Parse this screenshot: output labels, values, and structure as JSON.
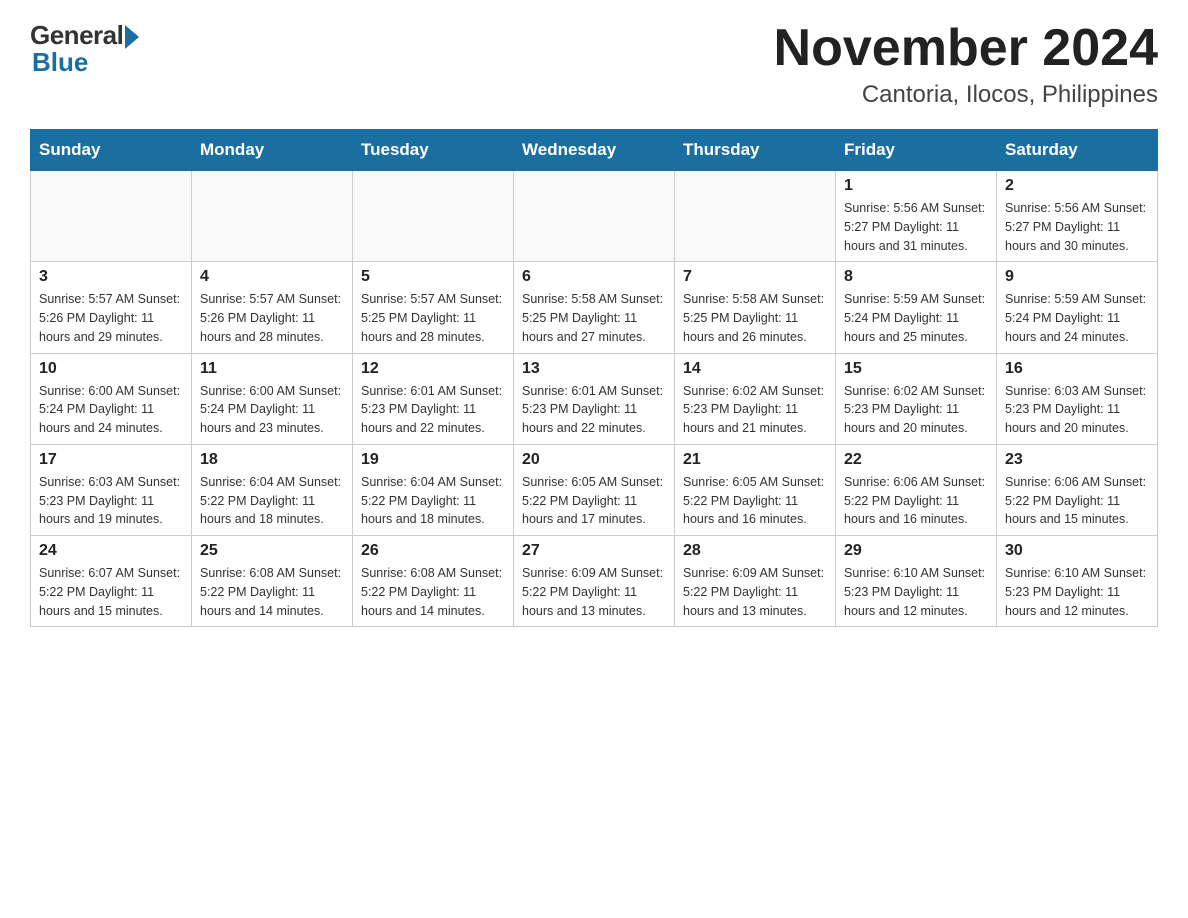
{
  "logo": {
    "general": "General",
    "blue": "Blue"
  },
  "title": "November 2024",
  "subtitle": "Cantoria, Ilocos, Philippines",
  "days_of_week": [
    "Sunday",
    "Monday",
    "Tuesday",
    "Wednesday",
    "Thursday",
    "Friday",
    "Saturday"
  ],
  "weeks": [
    [
      {
        "day": "",
        "info": ""
      },
      {
        "day": "",
        "info": ""
      },
      {
        "day": "",
        "info": ""
      },
      {
        "day": "",
        "info": ""
      },
      {
        "day": "",
        "info": ""
      },
      {
        "day": "1",
        "info": "Sunrise: 5:56 AM\nSunset: 5:27 PM\nDaylight: 11 hours and 31 minutes."
      },
      {
        "day": "2",
        "info": "Sunrise: 5:56 AM\nSunset: 5:27 PM\nDaylight: 11 hours and 30 minutes."
      }
    ],
    [
      {
        "day": "3",
        "info": "Sunrise: 5:57 AM\nSunset: 5:26 PM\nDaylight: 11 hours and 29 minutes."
      },
      {
        "day": "4",
        "info": "Sunrise: 5:57 AM\nSunset: 5:26 PM\nDaylight: 11 hours and 28 minutes."
      },
      {
        "day": "5",
        "info": "Sunrise: 5:57 AM\nSunset: 5:25 PM\nDaylight: 11 hours and 28 minutes."
      },
      {
        "day": "6",
        "info": "Sunrise: 5:58 AM\nSunset: 5:25 PM\nDaylight: 11 hours and 27 minutes."
      },
      {
        "day": "7",
        "info": "Sunrise: 5:58 AM\nSunset: 5:25 PM\nDaylight: 11 hours and 26 minutes."
      },
      {
        "day": "8",
        "info": "Sunrise: 5:59 AM\nSunset: 5:24 PM\nDaylight: 11 hours and 25 minutes."
      },
      {
        "day": "9",
        "info": "Sunrise: 5:59 AM\nSunset: 5:24 PM\nDaylight: 11 hours and 24 minutes."
      }
    ],
    [
      {
        "day": "10",
        "info": "Sunrise: 6:00 AM\nSunset: 5:24 PM\nDaylight: 11 hours and 24 minutes."
      },
      {
        "day": "11",
        "info": "Sunrise: 6:00 AM\nSunset: 5:24 PM\nDaylight: 11 hours and 23 minutes."
      },
      {
        "day": "12",
        "info": "Sunrise: 6:01 AM\nSunset: 5:23 PM\nDaylight: 11 hours and 22 minutes."
      },
      {
        "day": "13",
        "info": "Sunrise: 6:01 AM\nSunset: 5:23 PM\nDaylight: 11 hours and 22 minutes."
      },
      {
        "day": "14",
        "info": "Sunrise: 6:02 AM\nSunset: 5:23 PM\nDaylight: 11 hours and 21 minutes."
      },
      {
        "day": "15",
        "info": "Sunrise: 6:02 AM\nSunset: 5:23 PM\nDaylight: 11 hours and 20 minutes."
      },
      {
        "day": "16",
        "info": "Sunrise: 6:03 AM\nSunset: 5:23 PM\nDaylight: 11 hours and 20 minutes."
      }
    ],
    [
      {
        "day": "17",
        "info": "Sunrise: 6:03 AM\nSunset: 5:23 PM\nDaylight: 11 hours and 19 minutes."
      },
      {
        "day": "18",
        "info": "Sunrise: 6:04 AM\nSunset: 5:22 PM\nDaylight: 11 hours and 18 minutes."
      },
      {
        "day": "19",
        "info": "Sunrise: 6:04 AM\nSunset: 5:22 PM\nDaylight: 11 hours and 18 minutes."
      },
      {
        "day": "20",
        "info": "Sunrise: 6:05 AM\nSunset: 5:22 PM\nDaylight: 11 hours and 17 minutes."
      },
      {
        "day": "21",
        "info": "Sunrise: 6:05 AM\nSunset: 5:22 PM\nDaylight: 11 hours and 16 minutes."
      },
      {
        "day": "22",
        "info": "Sunrise: 6:06 AM\nSunset: 5:22 PM\nDaylight: 11 hours and 16 minutes."
      },
      {
        "day": "23",
        "info": "Sunrise: 6:06 AM\nSunset: 5:22 PM\nDaylight: 11 hours and 15 minutes."
      }
    ],
    [
      {
        "day": "24",
        "info": "Sunrise: 6:07 AM\nSunset: 5:22 PM\nDaylight: 11 hours and 15 minutes."
      },
      {
        "day": "25",
        "info": "Sunrise: 6:08 AM\nSunset: 5:22 PM\nDaylight: 11 hours and 14 minutes."
      },
      {
        "day": "26",
        "info": "Sunrise: 6:08 AM\nSunset: 5:22 PM\nDaylight: 11 hours and 14 minutes."
      },
      {
        "day": "27",
        "info": "Sunrise: 6:09 AM\nSunset: 5:22 PM\nDaylight: 11 hours and 13 minutes."
      },
      {
        "day": "28",
        "info": "Sunrise: 6:09 AM\nSunset: 5:22 PM\nDaylight: 11 hours and 13 minutes."
      },
      {
        "day": "29",
        "info": "Sunrise: 6:10 AM\nSunset: 5:23 PM\nDaylight: 11 hours and 12 minutes."
      },
      {
        "day": "30",
        "info": "Sunrise: 6:10 AM\nSunset: 5:23 PM\nDaylight: 11 hours and 12 minutes."
      }
    ]
  ]
}
